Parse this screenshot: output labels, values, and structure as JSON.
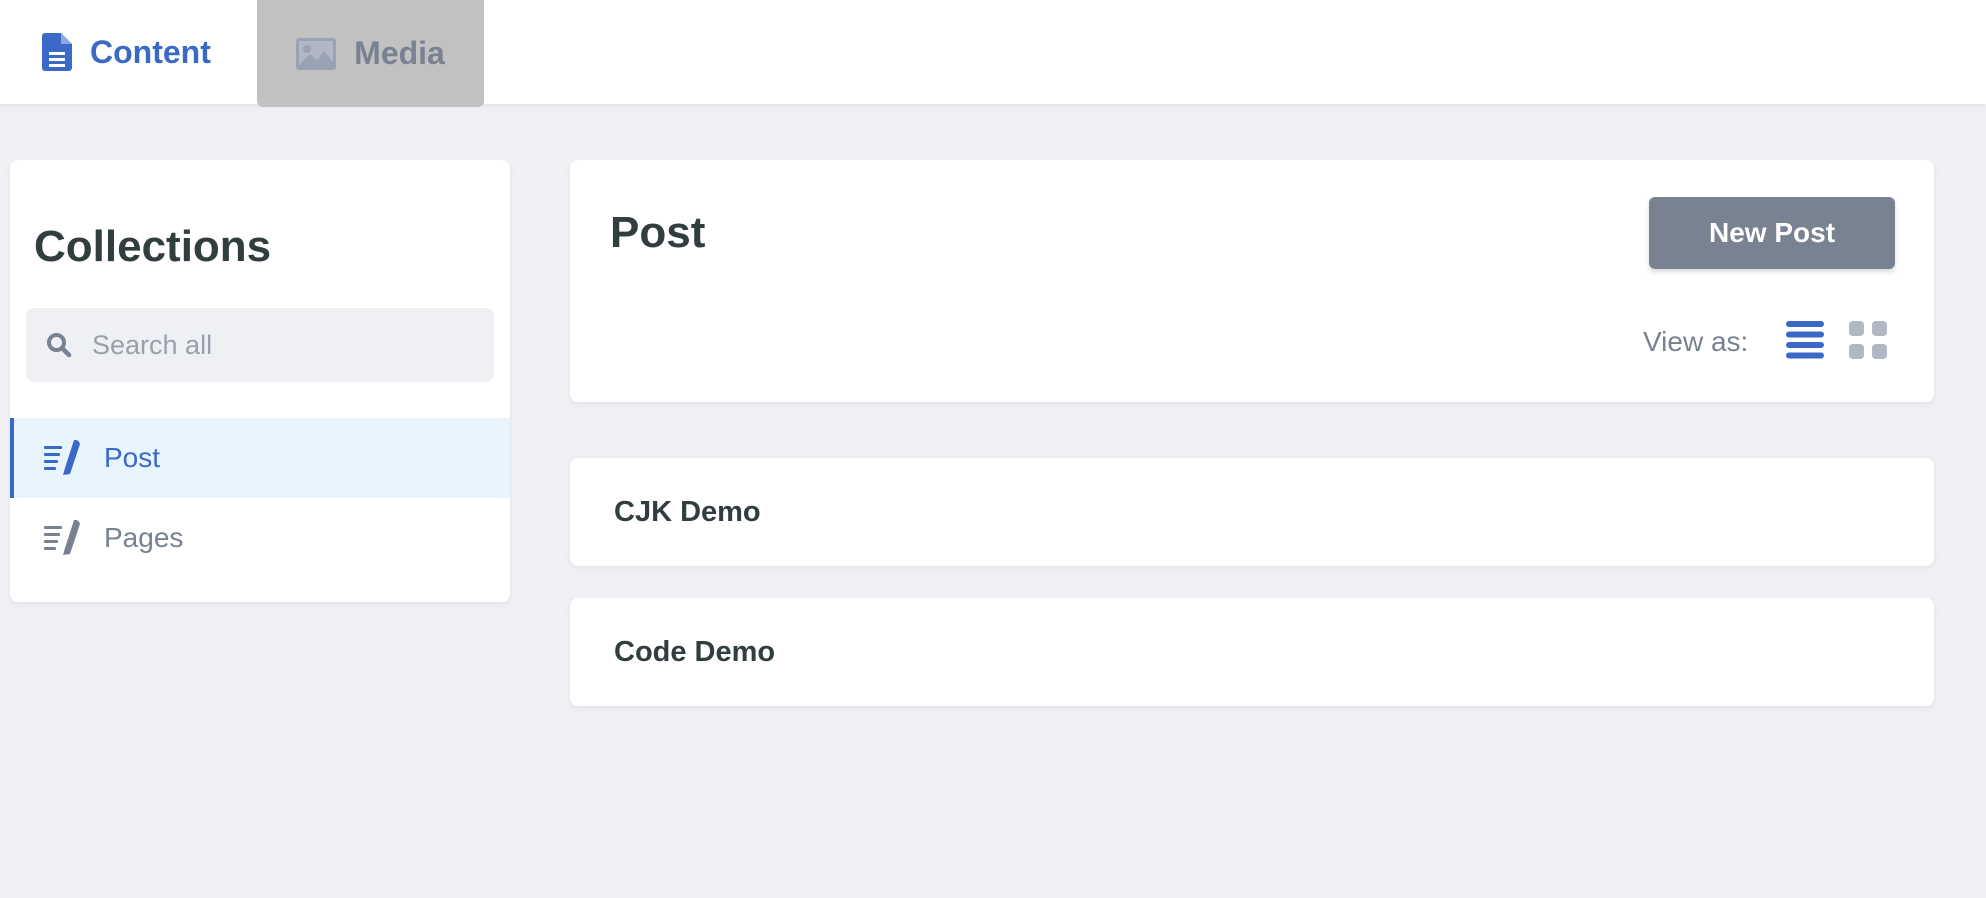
{
  "header": {
    "tabs": [
      {
        "label": "Content",
        "icon": "document-icon",
        "active": true
      },
      {
        "label": "Media",
        "icon": "image-icon",
        "active": false
      }
    ]
  },
  "sidebar": {
    "title": "Collections",
    "search_placeholder": "Search all",
    "items": [
      {
        "label": "Post",
        "icon": "write-icon",
        "active": true
      },
      {
        "label": "Pages",
        "icon": "write-icon",
        "active": false
      }
    ]
  },
  "main": {
    "title": "Post",
    "new_button_label": "New Post",
    "view_as_label": "View as:",
    "entries": [
      {
        "title": "CJK Demo"
      },
      {
        "title": "Code Demo"
      }
    ]
  },
  "colors": {
    "accent": "#3a69c7",
    "muted": "#798291",
    "background": "#eff0f4",
    "active_item_bg": "#e8f5fe"
  }
}
